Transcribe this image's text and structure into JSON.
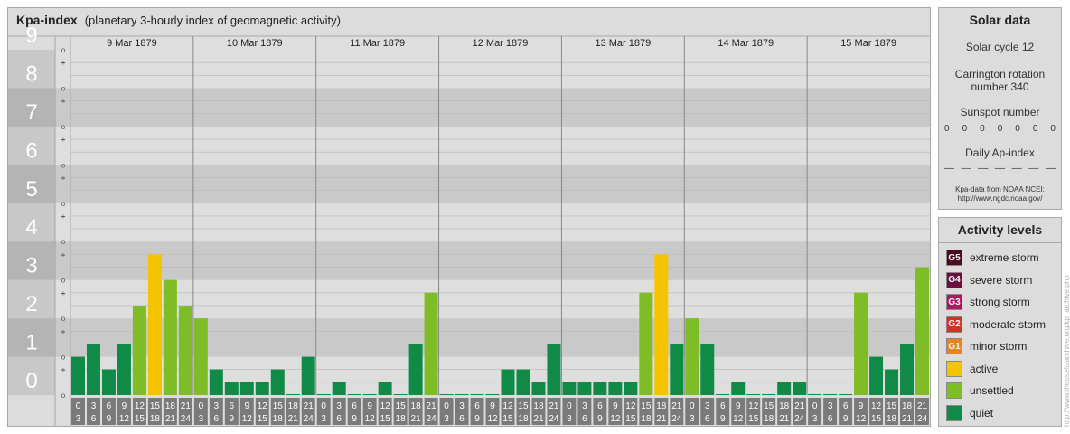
{
  "header": {
    "title": "Kpa-index",
    "subtitle": "(planetary 3-hourly index of geomagnetic activity)"
  },
  "colors": {
    "quiet": "#0f8a47",
    "unsettled": "#7ebd25",
    "active": "#f5c400",
    "minor": "#e5851f",
    "moderate": "#c9381f",
    "strong": "#b0155d",
    "severe": "#6d0e3c",
    "extreme": "#4a0a22"
  },
  "chart_data": {
    "type": "bar",
    "title": "Kpa-index",
    "subtitle": "(planetary 3-hourly index of geomagnetic activity)",
    "ylim": [
      0,
      9
    ],
    "y_ticks": [
      "0",
      "1",
      "2",
      "3",
      "4",
      "5",
      "6",
      "7",
      "8",
      "9"
    ],
    "minor_ticks": [
      "+",
      "o",
      "–"
    ],
    "days": [
      "9 Mar 1879",
      "10 Mar 1879",
      "11 Mar 1879",
      "12 Mar 1879",
      "13 Mar 1879",
      "14 Mar 1879",
      "15 Mar 1879"
    ],
    "interval_labels": [
      [
        "0",
        "3"
      ],
      [
        "3",
        "6"
      ],
      [
        "6",
        "9"
      ],
      [
        "9",
        "12"
      ],
      [
        "12",
        "15"
      ],
      [
        "15",
        "18"
      ],
      [
        "18",
        "21"
      ],
      [
        "21",
        "24"
      ]
    ],
    "values": [
      [
        1.0,
        1.33,
        0.67,
        1.33,
        2.33,
        3.67,
        3.0,
        2.33
      ],
      [
        2.0,
        0.67,
        0.33,
        0.33,
        0.33,
        0.67,
        0.0,
        1.0
      ],
      [
        0.0,
        0.33,
        0.0,
        0.0,
        0.33,
        0.0,
        1.33,
        2.67
      ],
      [
        0.0,
        0.0,
        0.0,
        0.0,
        0.67,
        0.67,
        0.33,
        1.33
      ],
      [
        0.33,
        0.33,
        0.33,
        0.33,
        0.33,
        2.67,
        3.67,
        1.33
      ],
      [
        2.0,
        1.33,
        0.0,
        0.33,
        0.0,
        0.0,
        0.33,
        0.33
      ],
      [
        0.0,
        0.0,
        0.0,
        2.67,
        1.0,
        0.67,
        1.33,
        3.33
      ]
    ]
  },
  "solar": {
    "title": "Solar data",
    "cycle": "Solar cycle 12",
    "carrington_1": "Carrington rotation",
    "carrington_2": "number 340",
    "sunspot_label": "Sunspot number",
    "sunspot_values": [
      "0",
      "0",
      "0",
      "0",
      "0",
      "0",
      "0"
    ],
    "ap_label": "Daily Ap-index",
    "ap_values": [
      "––",
      "––",
      "––",
      "––",
      "––",
      "––",
      "––"
    ],
    "source_1": "Kpa-data from NOAA NCEI:",
    "source_2": "http://www.ngdc.noaa.gov/"
  },
  "levels": {
    "title": "Activity levels",
    "items": [
      {
        "badge": "G5",
        "label": "extreme storm",
        "color": "#4a0a22"
      },
      {
        "badge": "G4",
        "label": "severe storm",
        "color": "#6d0e3c"
      },
      {
        "badge": "G3",
        "label": "strong storm",
        "color": "#b0155d"
      },
      {
        "badge": "G2",
        "label": "moderate storm",
        "color": "#c9381f"
      },
      {
        "badge": "G1",
        "label": "minor storm",
        "color": "#e5851f"
      },
      {
        "badge": "",
        "label": "active",
        "color": "#f5c400"
      },
      {
        "badge": "",
        "label": "unsettled",
        "color": "#7ebd25"
      },
      {
        "badge": "",
        "label": "quiet",
        "color": "#0f8a47"
      }
    ]
  },
  "credit": "http://www.theusefularchive.org/kp_archive.php"
}
